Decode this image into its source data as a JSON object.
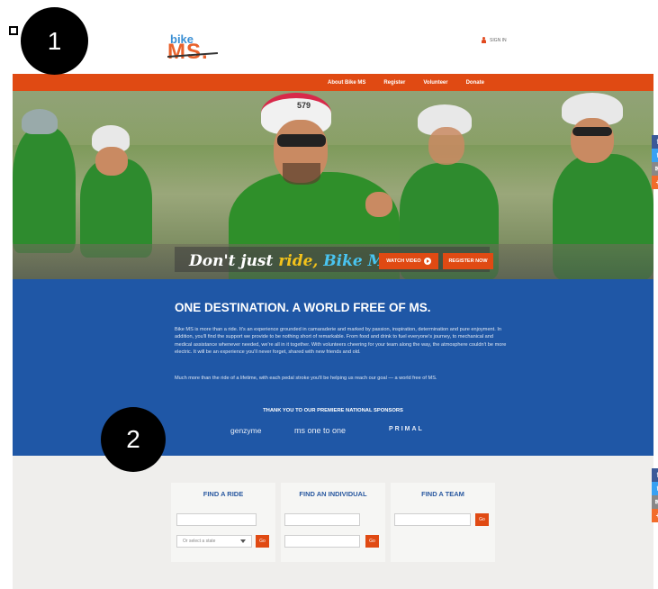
{
  "header": {
    "logo_top": "bike",
    "logo_main": "MS.",
    "signin_label": "SIGN IN"
  },
  "nav": {
    "items": [
      "About Bike MS",
      "Register",
      "Volunteer",
      "Donate"
    ]
  },
  "hero": {
    "tagline_a": "Don't just ",
    "tagline_b": "ride,",
    "tagline_c": " Bike MS",
    "watch_video": "WATCH VIDEO",
    "register_now": "REGISTER NOW",
    "bib_number": "579"
  },
  "social": {
    "facebook": "f",
    "twitter": "t",
    "email": "✉",
    "more": "+"
  },
  "mission": {
    "heading": "ONE DESTINATION. A WORLD FREE OF MS.",
    "para1": "Bike MS is more than a ride. It's an experience grounded in camaraderie and marked by passion, inspiration, determination and pure enjoyment. In addition, you'll find the support we provide to be nothing short of remarkable. From food and drink to fuel everyone's journey, to mechanical and medical assistance whenever needed, we're all in it together. With volunteers cheering for your team along the way, the atmosphere couldn't be more electric. It will be an experience you'll never forget, shared with new friends and old.",
    "para2": "Much more than the ride of a lifetime, with each pedal stroke you'll be helping us reach our goal — a world free of MS.",
    "sponsors_heading": "THANK YOU TO OUR PREMIERE NATIONAL SPONSORS",
    "sponsors": [
      "genzyme",
      "ms one to one",
      "PRIMAL"
    ]
  },
  "find": {
    "ride": {
      "title": "FIND A RIDE",
      "state_placeholder": "Or select a state",
      "go": "Go"
    },
    "individual": {
      "title": "FIND AN INDIVIDUAL",
      "go": "Go"
    },
    "team": {
      "title": "FIND A TEAM",
      "go": "Go"
    }
  },
  "markers": [
    "1",
    "2"
  ],
  "colors": {
    "accent": "#e04a13",
    "blue": "#1f57a6",
    "logo_blue": "#3b8fd4"
  }
}
